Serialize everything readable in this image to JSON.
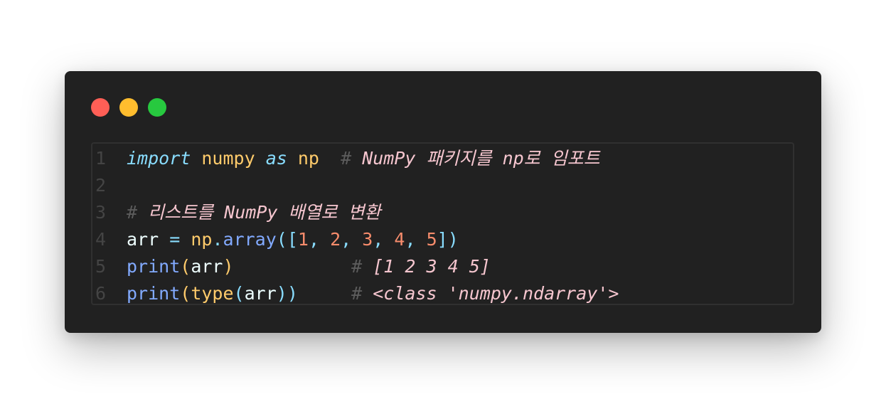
{
  "window": {
    "controls": [
      "close",
      "minimize",
      "maximize"
    ]
  },
  "lines": [
    {
      "n": "1",
      "tokens": [
        {
          "t": "import",
          "c": "kw"
        },
        {
          "t": " ",
          "c": "var"
        },
        {
          "t": "numpy",
          "c": "mod"
        },
        {
          "t": " ",
          "c": "var"
        },
        {
          "t": "as",
          "c": "kw"
        },
        {
          "t": " ",
          "c": "var"
        },
        {
          "t": "np",
          "c": "mod"
        },
        {
          "t": "  ",
          "c": "var"
        },
        {
          "t": "#",
          "c": "hash"
        },
        {
          "t": " NumPy 패키지를 np로 임포트",
          "c": "cm"
        }
      ]
    },
    {
      "n": "2",
      "tokens": []
    },
    {
      "n": "3",
      "tokens": [
        {
          "t": "#",
          "c": "hash"
        },
        {
          "t": " 리스트를 NumPy 배열로 변환",
          "c": "cm"
        }
      ]
    },
    {
      "n": "4",
      "tokens": [
        {
          "t": "arr",
          "c": "var"
        },
        {
          "t": " ",
          "c": "var"
        },
        {
          "t": "=",
          "c": "op"
        },
        {
          "t": " ",
          "c": "var"
        },
        {
          "t": "np",
          "c": "mod"
        },
        {
          "t": ".",
          "c": "op"
        },
        {
          "t": "array",
          "c": "fn"
        },
        {
          "t": "([",
          "c": "punc"
        },
        {
          "t": "1",
          "c": "num"
        },
        {
          "t": ", ",
          "c": "punc"
        },
        {
          "t": "2",
          "c": "num"
        },
        {
          "t": ", ",
          "c": "punc"
        },
        {
          "t": "3",
          "c": "num"
        },
        {
          "t": ", ",
          "c": "punc"
        },
        {
          "t": "4",
          "c": "num"
        },
        {
          "t": ", ",
          "c": "punc"
        },
        {
          "t": "5",
          "c": "num"
        },
        {
          "t": "])",
          "c": "punc"
        }
      ]
    },
    {
      "n": "5",
      "tokens": [
        {
          "t": "print",
          "c": "fn"
        },
        {
          "t": "(",
          "c": "mod"
        },
        {
          "t": "arr",
          "c": "var"
        },
        {
          "t": ")",
          "c": "mod"
        },
        {
          "t": "           ",
          "c": "var"
        },
        {
          "t": "#",
          "c": "hash"
        },
        {
          "t": " [1 2 3 4 5]",
          "c": "cm"
        }
      ]
    },
    {
      "n": "6",
      "tokens": [
        {
          "t": "print",
          "c": "fn"
        },
        {
          "t": "(",
          "c": "mod"
        },
        {
          "t": "type",
          "c": "mod"
        },
        {
          "t": "(",
          "c": "op"
        },
        {
          "t": "arr",
          "c": "var"
        },
        {
          "t": "))",
          "c": "op"
        },
        {
          "t": "     ",
          "c": "var"
        },
        {
          "t": "#",
          "c": "hash"
        },
        {
          "t": " <class 'numpy.ndarray'>",
          "c": "cm"
        }
      ]
    }
  ]
}
